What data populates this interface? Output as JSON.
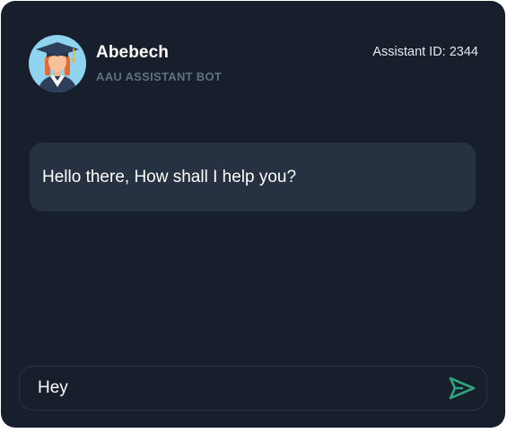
{
  "header": {
    "bot_name": "Abebech",
    "bot_role": "AAU ASSISTANT BOT",
    "assistant_id": "Assistant ID: 2344",
    "avatar_icon": "graduate-avatar-icon"
  },
  "messages": [
    {
      "sender": "bot",
      "text": "Hello there, How shall I help you?"
    }
  ],
  "composer": {
    "input_value": "Hey",
    "send_icon": "send-icon",
    "send_color": "#2fa57b"
  },
  "colors": {
    "background": "#161f2b",
    "bubble": "#263142",
    "avatar_bg": "#8fd4ef",
    "role_text": "#5f7083"
  }
}
